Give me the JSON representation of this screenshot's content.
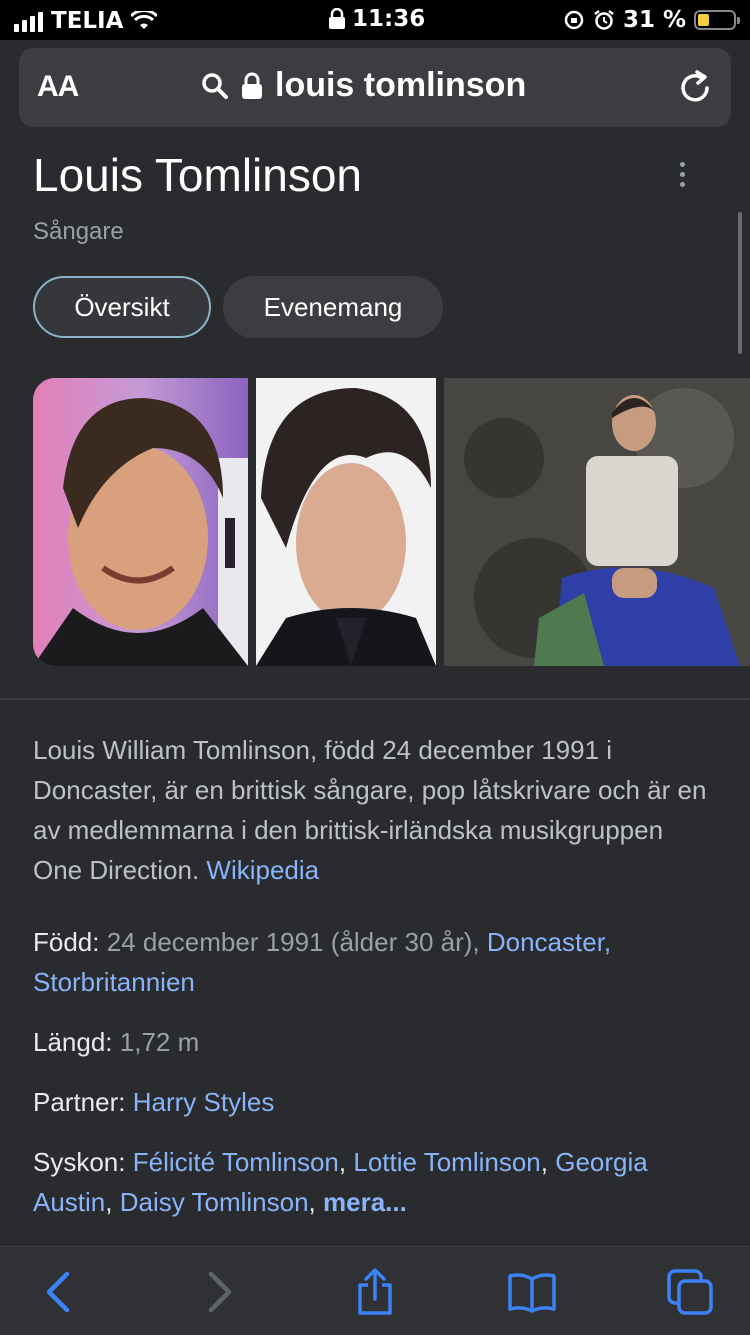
{
  "status": {
    "carrier": "TELIA",
    "time": "11:36",
    "battery_percent": "31 %",
    "battery_level": 0.31
  },
  "url_bar": {
    "text_size_label": "AA",
    "query": "louis tomlinson"
  },
  "entity": {
    "name": "Louis Tomlinson",
    "type": "Sångare",
    "tabs": [
      "Översikt",
      "Evenemang"
    ]
  },
  "description": {
    "text": "Louis William Tomlinson, född 24 december 1991 i Doncaster, är en brittisk sångare, pop låtskrivare och är en av medlemmarna i den brittisk-irländska musikgruppen One Direction.",
    "source": "Wikipedia"
  },
  "facts": {
    "born_label": "Född:",
    "born_value": "24 december 1991 (ålder 30 år),",
    "born_place": "Doncaster, Storbritannien",
    "height_label": "Längd:",
    "height_value": "1,72 m",
    "partner_label": "Partner:",
    "partner_value": "Harry Styles",
    "siblings_label": "Syskon:",
    "sibling_1": "Félicité Tomlinson",
    "sibling_2": "Lottie Tomlinson",
    "sibling_3": "Georgia Austin",
    "sibling_4": "Daisy Tomlinson",
    "more": "mera..."
  },
  "colors": {
    "background": "#2a2b2f",
    "link": "#8ab4f8",
    "toolbar_accent": "#3b82f6"
  }
}
